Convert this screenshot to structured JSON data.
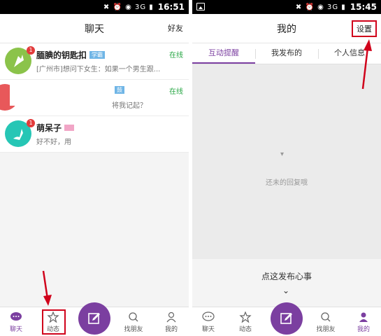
{
  "left_screen": {
    "status_time": "16:51",
    "status_icons": "✖ ⏰ ◉ 3G ▮",
    "title": "聊天",
    "top_right": "好友",
    "chats": [
      {
        "name": "腼腆的钥匙扣",
        "tag": "学霸",
        "status": "在线",
        "message": "[广州市]想问下女生：如果一个男生跟...",
        "badge": "1",
        "color": "#8bc34a"
      },
      {
        "name": "",
        "tag": "鼓",
        "status": "在线",
        "message": "将我记起？",
        "badge": "",
        "color": "#e8585a"
      },
      {
        "name": "萌呆子",
        "tag": "",
        "status": "",
        "message": "好不好，用",
        "badge": "1",
        "color": "#26c6b5"
      }
    ],
    "nav": [
      "聊天",
      "动态",
      "找朋友",
      "我的"
    ]
  },
  "right_screen": {
    "status_time": "15:45",
    "status_icons": "✖ ⏰ ◉ 3G ▮",
    "title": "我的",
    "top_right": "设置",
    "tabs": [
      "互动提醒",
      "我发布的",
      "个人信息"
    ],
    "empty_text": "还未的回复哦",
    "publish_text": "点这发布心事",
    "nav": [
      "聊天",
      "动态",
      "找朋友",
      "我的"
    ]
  },
  "colors": {
    "accent": "#7b3fa0",
    "annotation": "#d0021b",
    "online": "#28a745"
  }
}
